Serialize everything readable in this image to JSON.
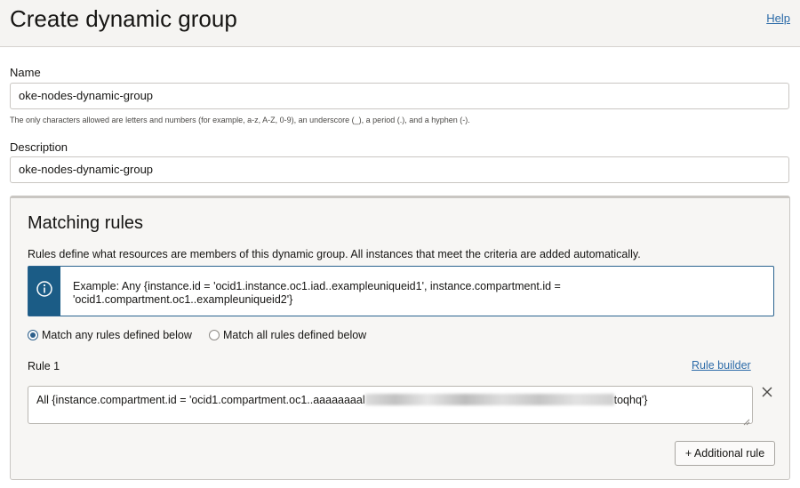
{
  "header": {
    "title": "Create dynamic group",
    "help_label": "Help"
  },
  "form": {
    "name_label": "Name",
    "name_value": "oke-nodes-dynamic-group",
    "name_hint": "The only characters allowed are letters and numbers (for example, a-z, A-Z, 0-9), an underscore (_), a period (.), and a hyphen (-).",
    "description_label": "Description",
    "description_value": "oke-nodes-dynamic-group"
  },
  "rules": {
    "title": "Matching rules",
    "description": "Rules define what resources are members of this dynamic group. All instances that meet the criteria are added automatically.",
    "info_line1": "Example: Any {instance.id = 'ocid1.instance.oc1.iad..exampleuniqueid1', instance.compartment.id =",
    "info_line2": "'ocid1.compartment.oc1..exampleuniqueid2'}",
    "match_options": [
      {
        "label": "Match any rules defined below",
        "selected": true
      },
      {
        "label": "Match all rules defined below",
        "selected": false
      }
    ],
    "rule_label": "Rule 1",
    "rule_builder_label": "Rule builder",
    "rule_text_start": "All {instance.compartment.id = 'ocid1.compartment.oc1..aaaaaaaal",
    "rule_text_end": "toqhq'}",
    "add_rule_label": "+ Additional rule"
  },
  "colors": {
    "accent": "#1b5c86",
    "link": "#2c6ba8",
    "header_bg": "#f5f4f2"
  },
  "icons": {
    "info": "info-circle-icon",
    "remove": "close-icon"
  }
}
